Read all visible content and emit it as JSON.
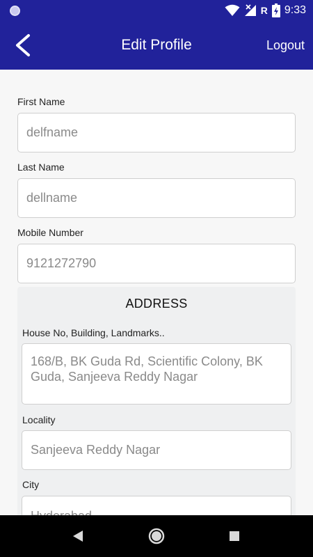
{
  "status_bar": {
    "time": "9:33",
    "network_letter": "R",
    "icons": [
      "notification-dot-icon",
      "wifi-icon",
      "cell-signal-icon",
      "battery-charging-icon"
    ]
  },
  "app_bar": {
    "title": "Edit Profile",
    "logout_label": "Logout",
    "back_icon": "chevron-left-icon"
  },
  "form": {
    "first_name": {
      "label": "First Name",
      "value": "delfname"
    },
    "last_name": {
      "label": "Last Name",
      "value": "dellname"
    },
    "mobile": {
      "label": "Mobile Number",
      "value": "9121272790"
    }
  },
  "address": {
    "heading": "ADDRESS",
    "house": {
      "label": "House No, Building, Landmarks..",
      "value": "168/B, BK Guda Rd, Scientific Colony, BK Guda, Sanjeeva Reddy Nagar"
    },
    "locality": {
      "label": "Locality",
      "value": "Sanjeeva Reddy Nagar"
    },
    "city": {
      "label": "City",
      "value": "Hyderabad"
    }
  },
  "nav_bar": {
    "icons": [
      "back-triangle-icon",
      "home-circle-icon",
      "recents-square-icon"
    ]
  },
  "colors": {
    "primary": "#21229a",
    "background": "#f7f7f7",
    "card": "#eff0f1"
  }
}
